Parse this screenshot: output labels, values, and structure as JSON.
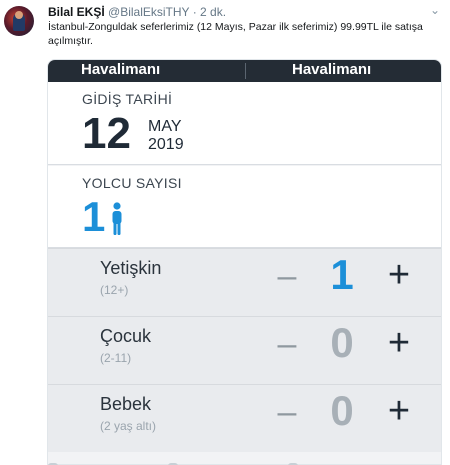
{
  "tweet": {
    "name": "Bilal EKŞİ",
    "handle": "@BilalEksiTHY",
    "dot": "·",
    "time": "2 dk.",
    "text": "İstanbul-Zonguldak seferlerimiz (12 Mayıs, Pazar ilk seferimiz) 99.99TL ile satışa açılmıştır."
  },
  "card": {
    "header": {
      "col1": "Havalimanı",
      "col2": "Havalimanı"
    },
    "departure": {
      "label": "GİDİŞ TARİHİ",
      "day": "12",
      "month": "MAY",
      "year": "2019"
    },
    "passengers": {
      "label": "YOLCU SAYISI",
      "count": "1",
      "rows": [
        {
          "label": "Yetişkin",
          "sub": "(12+)",
          "minus": "–",
          "value": "1",
          "plus": "+"
        },
        {
          "label": "Çocuk",
          "sub": "(2-11)",
          "minus": "–",
          "value": "0",
          "plus": "+"
        },
        {
          "label": "Bebek",
          "sub": "(2 yaş altı)",
          "minus": "–",
          "value": "0",
          "plus": "+"
        }
      ]
    }
  },
  "icons": {
    "chevron": "chevron-down-icon",
    "person": "person-icon",
    "avatar": "avatar"
  },
  "colors": {
    "header_bg": "#242c35",
    "accent_blue": "#1c8fd8",
    "row_bg": "#e9ebee"
  }
}
